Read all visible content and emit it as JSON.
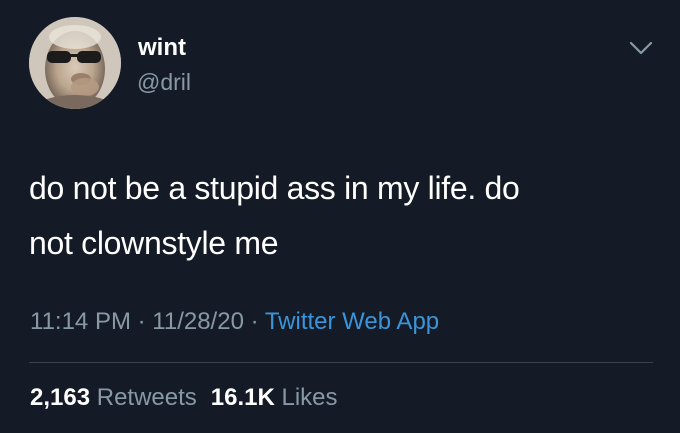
{
  "author": {
    "display_name": "wint",
    "handle": "@dril",
    "avatar": "avatar-photo"
  },
  "tweet": {
    "text_line1": "do not be a stupid ass in my life. do",
    "text_line2": "not clownstyle me",
    "time": "11:14 PM",
    "separator1": " · ",
    "date": "11/28/20",
    "separator2": " · ",
    "source": "Twitter Web App"
  },
  "stats": {
    "retweets_count": "2,163",
    "retweets_label": "Retweets",
    "likes_count": "16.1K",
    "likes_label": "Likes"
  },
  "icons": {
    "menu": "chevron-down-icon"
  },
  "colors": {
    "background": "#141b26",
    "text": "#ffffff",
    "secondary_text": "#8899a6",
    "link": "#3b94d9",
    "divider": "#38444d"
  }
}
